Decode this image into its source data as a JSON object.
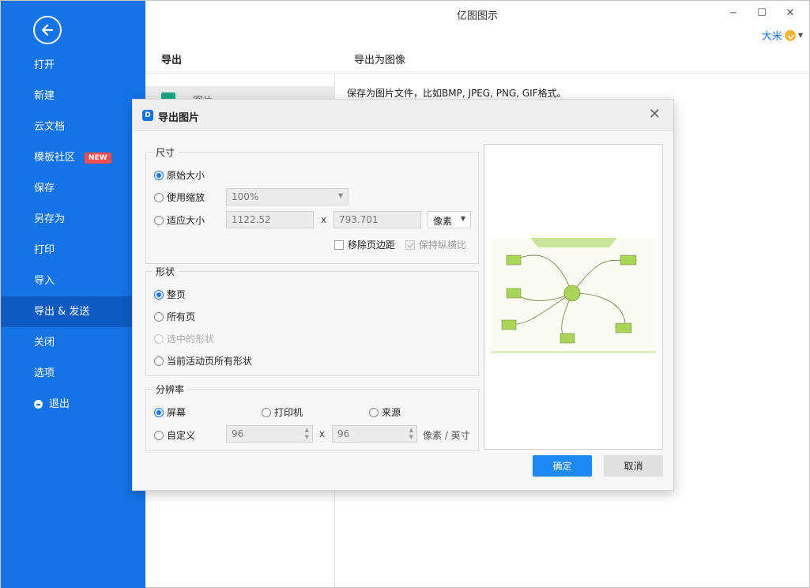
{
  "app": {
    "title": "亿图图示",
    "user_name": "大米"
  },
  "window_controls": {
    "minimize": "−",
    "maximize": "☐",
    "close": "✕"
  },
  "sidebar": {
    "items": [
      {
        "label": "打开"
      },
      {
        "label": "新建"
      },
      {
        "label": "云文档"
      },
      {
        "label": "模板社区",
        "badge": "NEW"
      },
      {
        "label": "保存"
      },
      {
        "label": "另存为"
      },
      {
        "label": "打印"
      },
      {
        "label": "导入"
      },
      {
        "label": "导出 & 发送",
        "active": true
      },
      {
        "label": "关闭"
      },
      {
        "label": "选项"
      },
      {
        "label": "退出",
        "icon": "exit-icon"
      }
    ]
  },
  "main": {
    "left_header": "导出",
    "right_header": "导出为图像",
    "selected_item": "图片",
    "description": "保存为图片文件，比如BMP, JPEG, PNG, GIF格式。"
  },
  "dialog": {
    "title": "导出图片",
    "size_group": {
      "title": "尺寸",
      "original": "原始大小",
      "use_scale": "使用缩放",
      "scale_value": "100%",
      "fit_size": "适应大小",
      "width": "1122.52",
      "height": "793.701",
      "times": "x",
      "unit": "像素",
      "remove_margin": "移除页边距",
      "keep_ratio": "保持纵横比"
    },
    "shape_group": {
      "title": "形状",
      "whole_page": "整页",
      "all_pages": "所有页",
      "selected_shapes": "选中的形状",
      "active_page_all": "当前活动页所有形状"
    },
    "resolution_group": {
      "title": "分辨率",
      "screen": "屏幕",
      "printer": "打印机",
      "source": "来源",
      "custom": "自定义",
      "dpi_x": "96",
      "dpi_y": "96",
      "times": "x",
      "unit": "像素 / 英寸"
    },
    "ok": "确定",
    "cancel": "取消"
  },
  "colors": {
    "sidebar": "#1473e6",
    "sidebar_active": "#0d5bc2",
    "primary_button": "#1e88f5",
    "mindmap_green": "#a9d558"
  }
}
